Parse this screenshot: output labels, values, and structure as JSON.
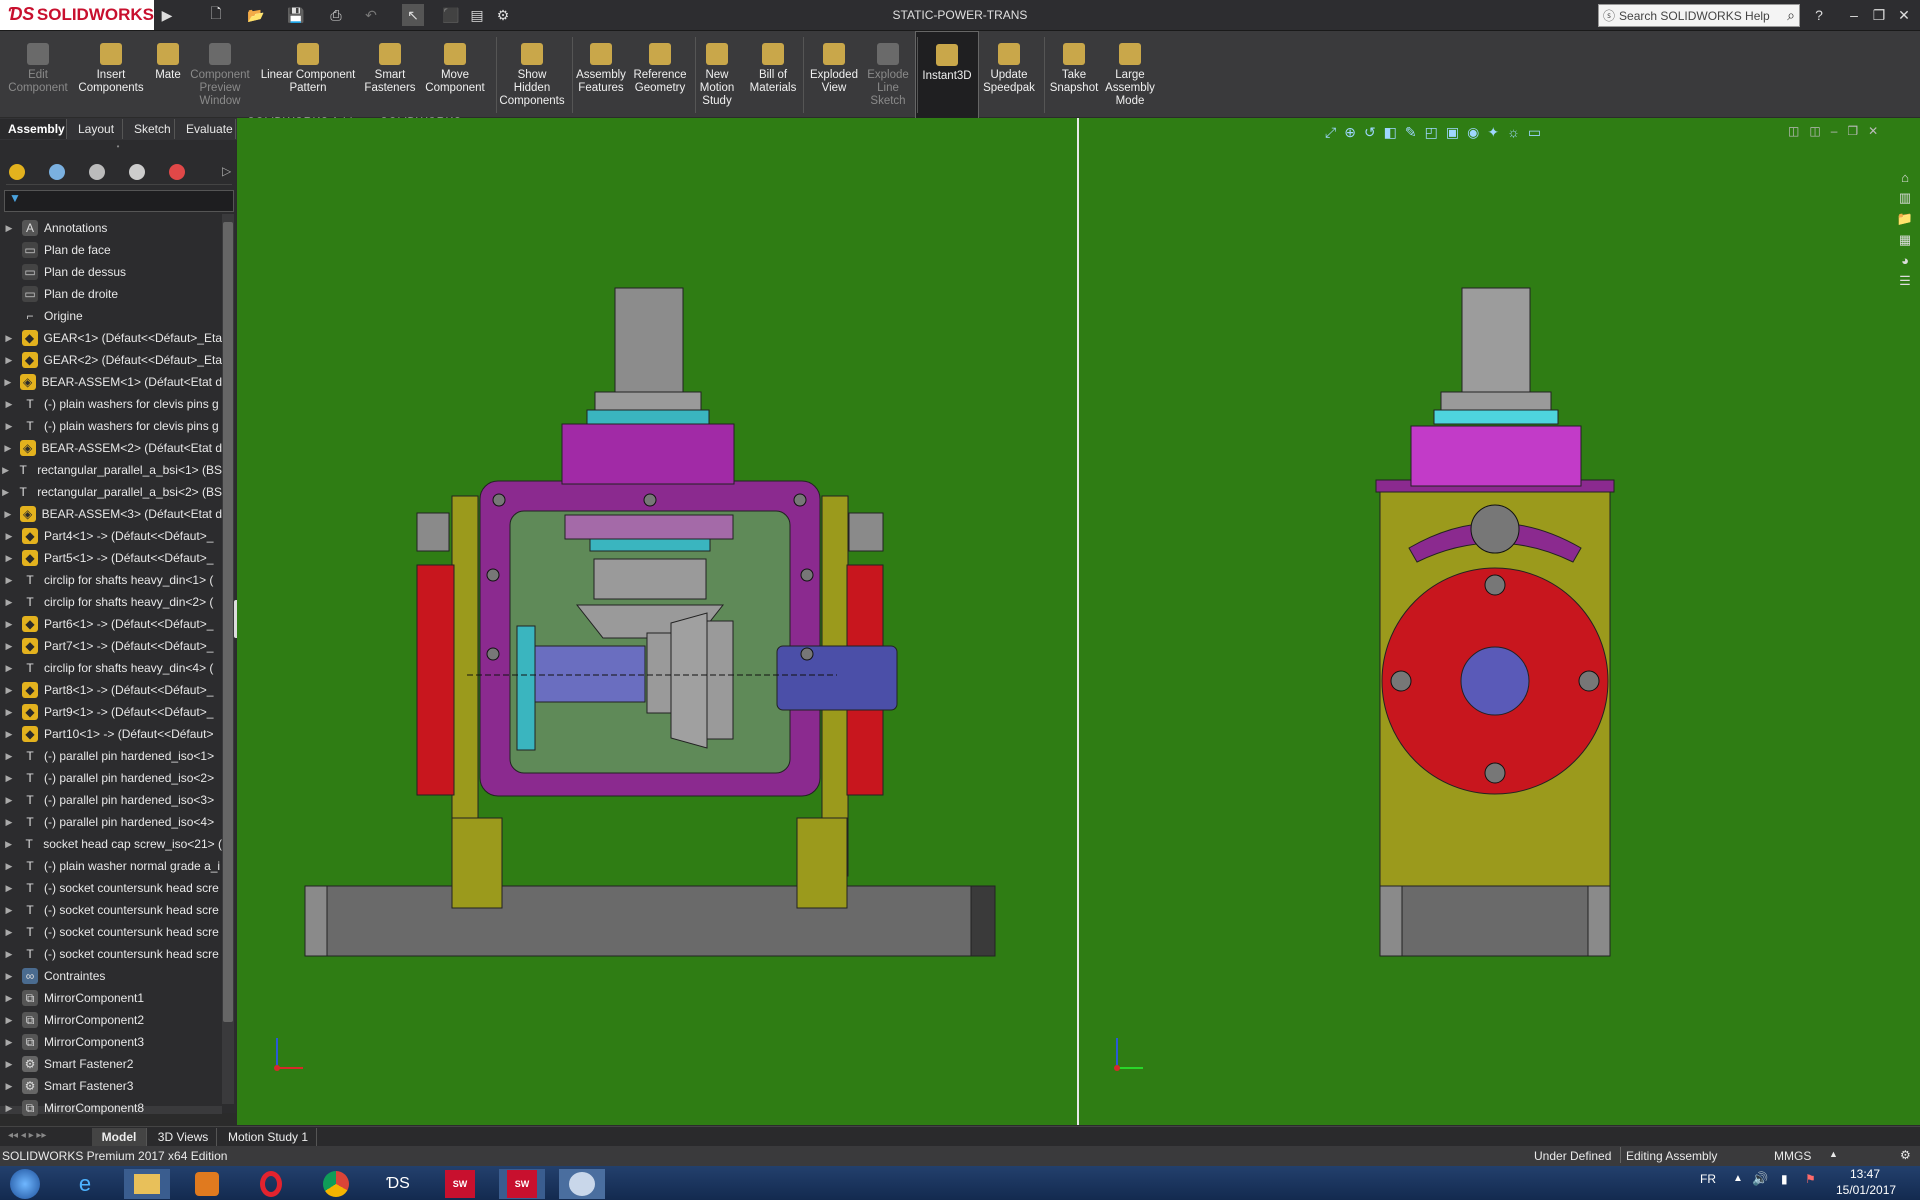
{
  "window": {
    "title": "STATIC-POWER-TRANS",
    "brand": "SOLIDWORKS",
    "search_placeholder": "Search SOLIDWORKS Help"
  },
  "commands": [
    {
      "label": "Edit\nComponent",
      "disabled": true
    },
    {
      "label": "Insert\nComponents",
      "disabled": false
    },
    {
      "label": "Mate",
      "disabled": false
    },
    {
      "label": "Component\nPreview\nWindow",
      "disabled": true
    },
    {
      "label": "Linear Component\nPattern",
      "disabled": false
    },
    {
      "label": "Smart\nFasteners",
      "disabled": false
    },
    {
      "label": "Move\nComponent",
      "disabled": false
    },
    {
      "label": "Show\nHidden\nComponents",
      "disabled": false
    },
    {
      "label": "Assembly\nFeatures",
      "disabled": false
    },
    {
      "label": "Reference\nGeometry",
      "disabled": false
    },
    {
      "label": "New\nMotion\nStudy",
      "disabled": false
    },
    {
      "label": "Bill of\nMaterials",
      "disabled": false
    },
    {
      "label": "Exploded\nView",
      "disabled": false
    },
    {
      "label": "Explode\nLine\nSketch",
      "disabled": true
    },
    {
      "label": "Instant3D",
      "disabled": false
    },
    {
      "label": "Update\nSpeedpak",
      "disabled": false
    },
    {
      "label": "Take\nSnapshot",
      "disabled": false
    },
    {
      "label": "Large\nAssembly\nMode",
      "disabled": false
    }
  ],
  "tabs": [
    "Assembly",
    "Layout",
    "Sketch",
    "Evaluate",
    "SOLIDWORKS Add-Ins",
    "SOLIDWORKS MBD"
  ],
  "tree": [
    {
      "label": "Annotations",
      "icon": "annotations-icon",
      "expand": true
    },
    {
      "label": "Plan de face",
      "icon": "plane-icon",
      "expand": false
    },
    {
      "label": "Plan de dessus",
      "icon": "plane-icon",
      "expand": false
    },
    {
      "label": "Plan de droite",
      "icon": "plane-icon",
      "expand": false
    },
    {
      "label": "Origine",
      "icon": "origin-icon",
      "expand": false
    },
    {
      "label": "GEAR<1> (Défaut<<Défaut>_Eta",
      "icon": "part-icon",
      "expand": true
    },
    {
      "label": "GEAR<2> (Défaut<<Défaut>_Eta",
      "icon": "part-icon",
      "expand": true
    },
    {
      "label": "BEAR-ASSEM<1> (Défaut<Etat d",
      "icon": "assembly-icon",
      "expand": true
    },
    {
      "label": "(-) plain washers for clevis pins g",
      "icon": "toolbox-part-icon",
      "expand": true
    },
    {
      "label": "(-) plain washers for clevis pins g",
      "icon": "toolbox-part-icon",
      "expand": true
    },
    {
      "label": "BEAR-ASSEM<2> (Défaut<Etat d",
      "icon": "assembly-icon",
      "expand": true
    },
    {
      "label": "rectangular_parallel_a_bsi<1> (BS",
      "icon": "toolbox-part-icon",
      "expand": true
    },
    {
      "label": "rectangular_parallel_a_bsi<2> (BS",
      "icon": "toolbox-part-icon",
      "expand": true
    },
    {
      "label": "BEAR-ASSEM<3> (Défaut<Etat d",
      "icon": "assembly-icon",
      "expand": true
    },
    {
      "label": "Part4<1> -> (Défaut<<Défaut>_",
      "icon": "part-icon",
      "expand": true
    },
    {
      "label": "Part5<1> -> (Défaut<<Défaut>_",
      "icon": "part-icon",
      "expand": true
    },
    {
      "label": "circlip for shafts heavy_din<1> (",
      "icon": "toolbox-part-icon",
      "expand": true
    },
    {
      "label": "circlip for shafts heavy_din<2> (",
      "icon": "toolbox-part-icon",
      "expand": true
    },
    {
      "label": "Part6<1> -> (Défaut<<Défaut>_",
      "icon": "part-icon",
      "expand": true
    },
    {
      "label": "Part7<1> -> (Défaut<<Défaut>_",
      "icon": "part-icon",
      "expand": true
    },
    {
      "label": "circlip for shafts heavy_din<4> (",
      "icon": "toolbox-part-icon",
      "expand": true
    },
    {
      "label": "Part8<1> -> (Défaut<<Défaut>_",
      "icon": "part-icon",
      "expand": true
    },
    {
      "label": "Part9<1> -> (Défaut<<Défaut>_",
      "icon": "part-icon",
      "expand": true
    },
    {
      "label": "Part10<1> -> (Défaut<<Défaut>",
      "icon": "part-icon",
      "expand": true
    },
    {
      "label": "(-) parallel pin hardened_iso<1>",
      "icon": "toolbox-part-icon",
      "expand": true
    },
    {
      "label": "(-) parallel pin hardened_iso<2>",
      "icon": "toolbox-part-icon",
      "expand": true
    },
    {
      "label": "(-) parallel pin hardened_iso<3>",
      "icon": "toolbox-part-icon",
      "expand": true
    },
    {
      "label": "(-) parallel pin hardened_iso<4>",
      "icon": "toolbox-part-icon",
      "expand": true
    },
    {
      "label": "socket head cap screw_iso<21> (",
      "icon": "toolbox-part-icon",
      "expand": true
    },
    {
      "label": "(-) plain washer normal grade a_i",
      "icon": "toolbox-part-icon",
      "expand": true
    },
    {
      "label": "(-) socket countersunk head scre",
      "icon": "toolbox-part-icon",
      "expand": true
    },
    {
      "label": "(-) socket countersunk head scre",
      "icon": "toolbox-part-icon",
      "expand": true
    },
    {
      "label": "(-) socket countersunk head scre",
      "icon": "toolbox-part-icon",
      "expand": true
    },
    {
      "label": "(-) socket countersunk head scre",
      "icon": "toolbox-part-icon",
      "expand": true
    },
    {
      "label": "Contraintes",
      "icon": "mates-icon",
      "expand": true
    },
    {
      "label": "MirrorComponent1",
      "icon": "mirror-icon",
      "expand": true
    },
    {
      "label": "MirrorComponent2",
      "icon": "mirror-icon",
      "expand": true
    },
    {
      "label": "MirrorComponent3",
      "icon": "mirror-icon",
      "expand": true
    },
    {
      "label": "Smart Fastener2",
      "icon": "fastener-icon",
      "expand": true
    },
    {
      "label": "Smart Fastener3",
      "icon": "fastener-icon",
      "expand": true
    },
    {
      "label": "MirrorComponent8",
      "icon": "mirror-icon",
      "expand": true
    }
  ],
  "bottom_tabs": [
    "Model",
    "3D Views",
    "Motion Study 1"
  ],
  "status": {
    "edition": "SOLIDWORKS Premium 2017 x64 Edition",
    "state": "Under Defined",
    "mode": "Editing Assembly",
    "units": "MMGS"
  },
  "taskbar": {
    "lang": "FR",
    "time": "13:47",
    "date": "15/01/2017"
  },
  "colors": {
    "viewport_bg": "#2f7d14",
    "housing_purple": "#8b2a8f",
    "base_grey": "#6a6a6a",
    "flange_red": "#c8161e",
    "bracket_olive": "#9b9a1c",
    "accent": "#c8102e"
  }
}
